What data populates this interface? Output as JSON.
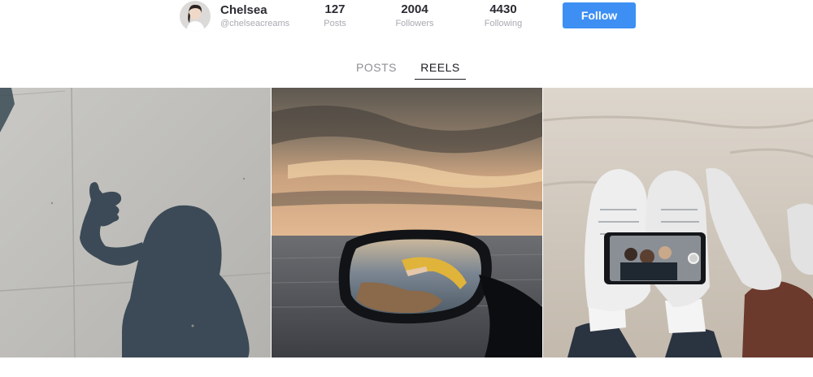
{
  "profile": {
    "name": "Chelsea",
    "handle": "@chelseacreams",
    "stats": [
      {
        "value": "127",
        "label": "Posts"
      },
      {
        "value": "2004",
        "label": "Followers"
      },
      {
        "value": "4430",
        "label": "Following"
      }
    ],
    "follow_label": "Follow",
    "accent_color": "#3d8ff3"
  },
  "tabs": [
    {
      "label": "POSTS",
      "active": false
    },
    {
      "label": "REELS",
      "active": true
    }
  ],
  "reels": [
    {
      "icon": "shadow-thumbs-up-photo"
    },
    {
      "icon": "sunset-car-mirror-photo"
    },
    {
      "icon": "beach-sneakers-selfie-photo"
    }
  ]
}
